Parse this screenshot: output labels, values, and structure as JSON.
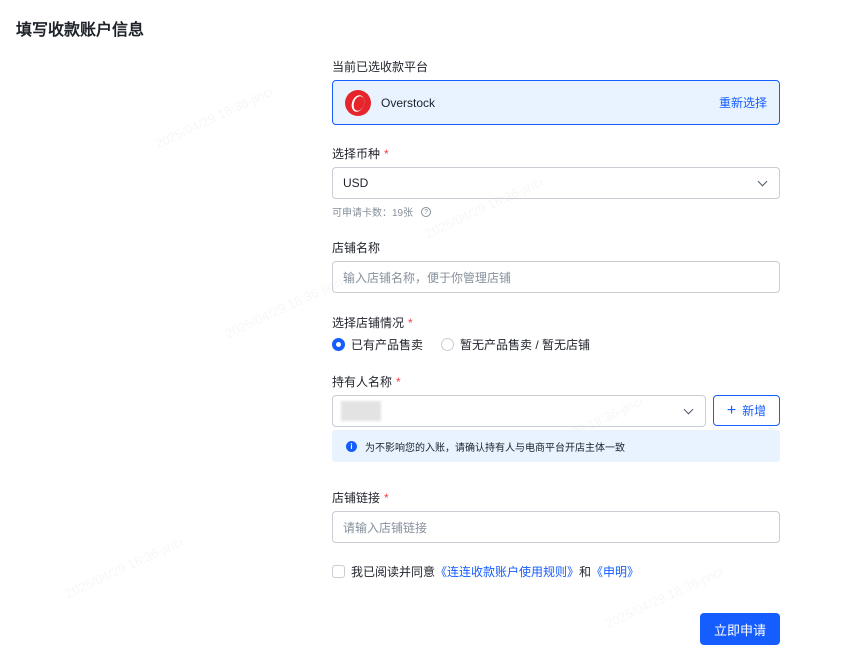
{
  "page_title": "填写收款账户信息",
  "watermark": "2025/04/29 18:36-jinci",
  "platform": {
    "label": "当前已选收款平台",
    "name": "Overstock",
    "reselect": "重新选择"
  },
  "currency": {
    "label": "选择币种",
    "required": "*",
    "value": "USD",
    "hint": "可申请卡数：19张",
    "help": "?"
  },
  "store_name": {
    "label": "店铺名称",
    "placeholder": "输入店铺名称，便于你管理店铺"
  },
  "store_status": {
    "label": "选择店铺情况",
    "required": "*",
    "options": [
      "已有产品售卖",
      "暂无产品售卖 / 暂无店铺"
    ],
    "selected": 0
  },
  "holder": {
    "label": "持有人名称",
    "required": "*",
    "add": "新增",
    "add_icon": "+",
    "notice": "为不影响您的入账，请确认持有人与电商平台开店主体一致",
    "info_icon": "i"
  },
  "store_link": {
    "label": "店铺链接",
    "required": "*",
    "placeholder": "请输入店铺链接"
  },
  "agreement": {
    "prefix": "我已阅读并同意",
    "rules": "《连连收款账户使用规则》",
    "and": "和",
    "statement": "《申明》"
  },
  "submit": "立即申请"
}
